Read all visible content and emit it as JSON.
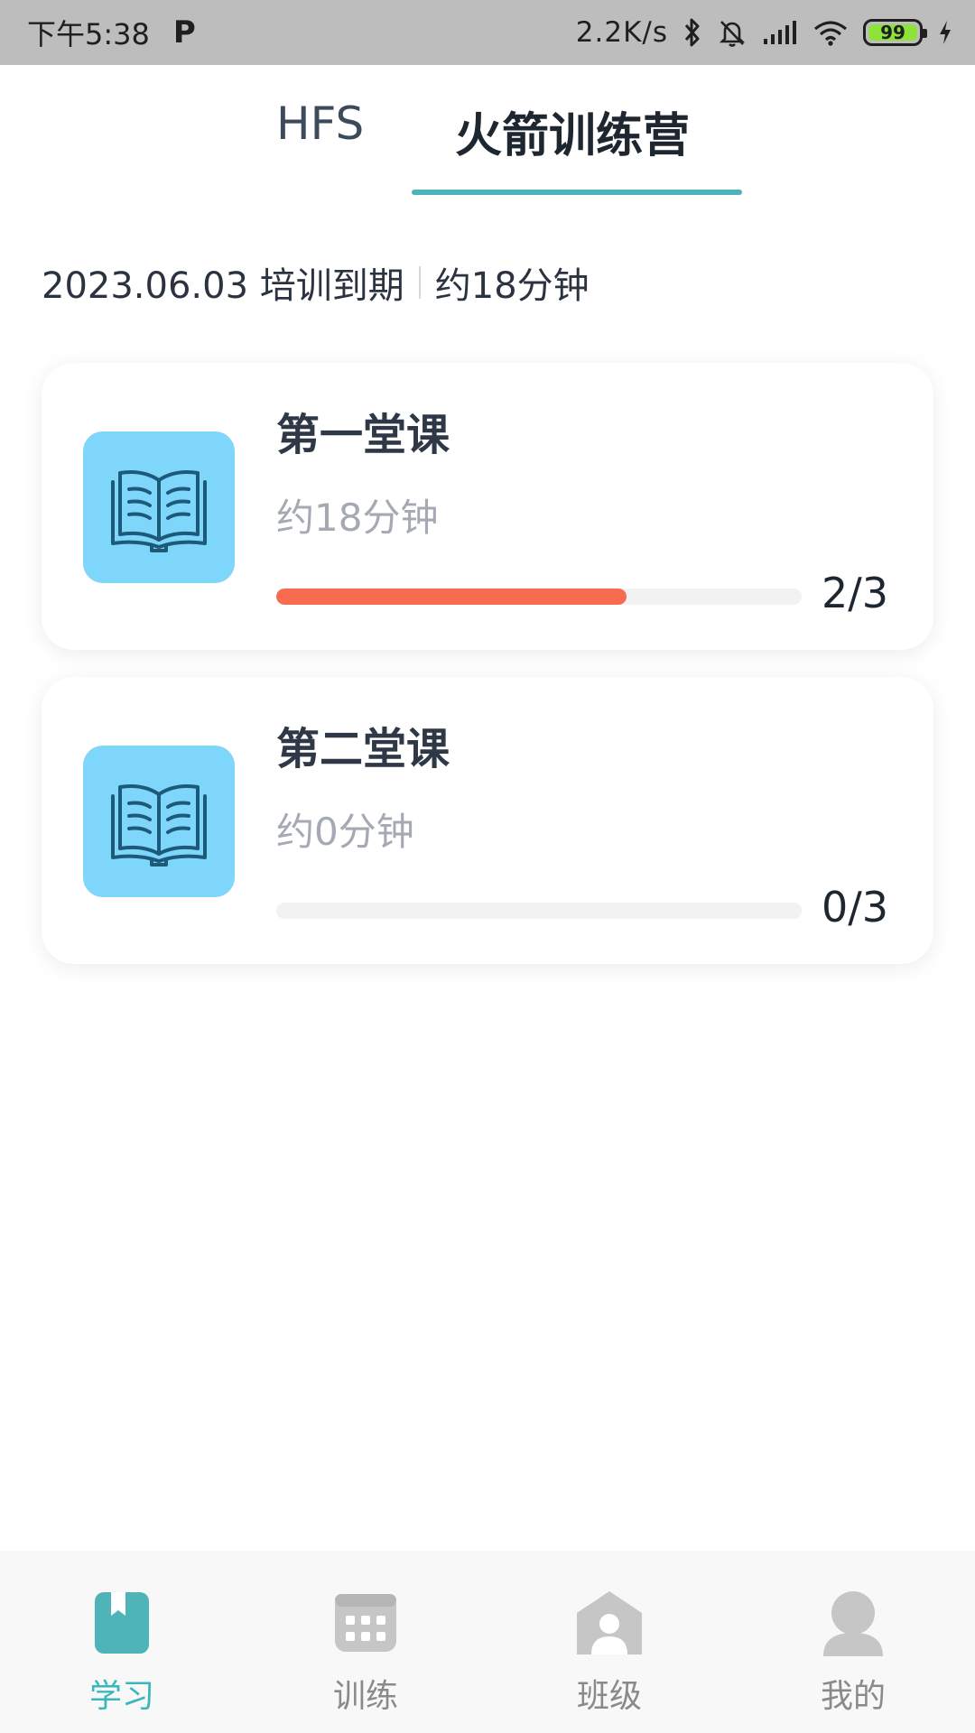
{
  "status_bar": {
    "time": "下午5:38",
    "app_letter": "P",
    "net_speed": "2.2K/s",
    "battery": "99"
  },
  "tabs": [
    {
      "label": "HFS",
      "active": false
    },
    {
      "label": "火箭训练营",
      "active": true
    }
  ],
  "info": {
    "expiry": "2023.06.03 培训到期",
    "duration": "约18分钟"
  },
  "courses": [
    {
      "title": "第一堂课",
      "duration": "约18分钟",
      "progress": "2/3",
      "progress_fraction": 0.667
    },
    {
      "title": "第二堂课",
      "duration": "约0分钟",
      "progress": "0/3",
      "progress_fraction": 0
    }
  ],
  "bottom_nav": [
    {
      "label": "学习",
      "icon": "study-book-icon",
      "active": true
    },
    {
      "label": "训练",
      "icon": "calendar-grid-icon",
      "active": false
    },
    {
      "label": "班级",
      "icon": "class-house-icon",
      "active": false
    },
    {
      "label": "我的",
      "icon": "profile-person-icon",
      "active": false
    }
  ],
  "colors": {
    "accent": "#3ab7bd",
    "tab_underline": "#4db3b8",
    "progress": "#f76c4f",
    "course_icon_bg": "#7fd6fb"
  }
}
